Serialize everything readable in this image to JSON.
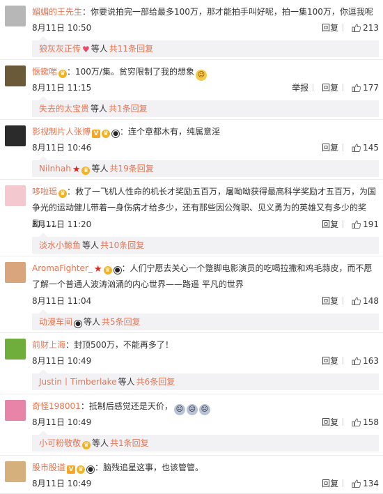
{
  "actions": {
    "reply_label": "回复",
    "report_label": "举报"
  },
  "comments": [
    {
      "username": "媚媚的王先生",
      "badges": [],
      "content": "你要说拍完一部给最多100万，那才能拍手叫好呢，拍一集100万，你逗我呢",
      "emojis": [],
      "time": "8月11日 10:50",
      "show_report": false,
      "likes": "213",
      "avatar_color": "#b7b7b7",
      "reply_preview": {
        "user": "狼灰灰正传",
        "badges": [
          "heart"
        ],
        "suffix": "等人",
        "count_text": "共11条回复"
      }
    },
    {
      "username": "惬鏉啱",
      "badges": [
        "crown"
      ],
      "content": "100万/集。贫穷限制了我的想象",
      "emojis": [
        "grin"
      ],
      "time": "8月11日 11:15",
      "show_report": true,
      "likes": "177",
      "avatar_color": "#6a5a3a",
      "reply_preview": {
        "user": "失去的太宝贵",
        "badges": [],
        "suffix": "等人",
        "count_text": "共1条回复"
      }
    },
    {
      "username": "影视制片人张博",
      "badges": [
        "v",
        "crown",
        "panda"
      ],
      "content": "连个章都木有，纯属意淫",
      "emojis": [],
      "time": "8月11日 10:46",
      "show_report": false,
      "likes": "145",
      "avatar_color": "#2b2b2b",
      "reply_preview": {
        "user": "Nilnhah",
        "badges": [
          "star",
          "crown"
        ],
        "suffix": "等人",
        "count_text": "共19条回复"
      }
    },
    {
      "username": "哆啦瑶",
      "badges": [
        "crown"
      ],
      "content": "救了一飞机人性命的机长才奖励五百万，屠呦呦获得最高科学奖励才五百万，为国争光的运动健儿带着一身伤病才给多少，还有那些因公殉职、见义勇为的英雄又有多少的奖励……",
      "emojis": [],
      "time": "8月11日 11:20",
      "show_report": false,
      "likes": "191",
      "avatar_color": "#f3c9cf",
      "reply_preview": {
        "user": "淡水小鲸鱼",
        "badges": [],
        "suffix": "等人",
        "count_text": "共10条回复"
      }
    },
    {
      "username": "AromaFighter_",
      "badges": [
        "star",
        "crown",
        "panda"
      ],
      "content": "人们宁愿去关心一个蹩脚电影演员的吃喝拉撒和鸡毛蒜皮，而不愿了解一个普通人波涛汹涌的内心世界——路遥 平凡的世界",
      "emojis": [],
      "time": "8月11日 11:04",
      "show_report": false,
      "likes": "148",
      "avatar_color": "#d9a57d",
      "reply_preview": {
        "user": "动漫车间",
        "badges": [
          "panda"
        ],
        "suffix": "等人",
        "count_text": "共5条回复"
      }
    },
    {
      "username": "前财上海",
      "badges": [],
      "content": "封顶500万，不能再多了！",
      "emojis": [],
      "time": "8月11日 10:49",
      "show_report": false,
      "likes": "163",
      "avatar_color": "#6fae3c",
      "reply_preview": {
        "user": "Justin丨Timberlake",
        "badges": [],
        "suffix": "等人",
        "count_text": "共6条回复"
      }
    },
    {
      "username": "奇怪198001",
      "badges": [],
      "content": "抵制后感觉还是天价，",
      "emojis": [
        "shock",
        "shock",
        "shock"
      ],
      "time": "8月11日 10:49",
      "show_report": false,
      "likes": "158",
      "avatar_color": "#e784a8",
      "reply_preview": {
        "user": "小可粉敬敬",
        "badges": [
          "crown"
        ],
        "suffix": "等人",
        "count_text": "共1条回复"
      }
    },
    {
      "username": "股市股道",
      "badges": [
        "v",
        "crown",
        "panda"
      ],
      "content": "脑残追星这事，也该管管。",
      "emojis": [],
      "time": "8月11日 10:49",
      "show_report": false,
      "likes": "134",
      "avatar_color": "#d6b07c",
      "reply_preview": null
    }
  ]
}
